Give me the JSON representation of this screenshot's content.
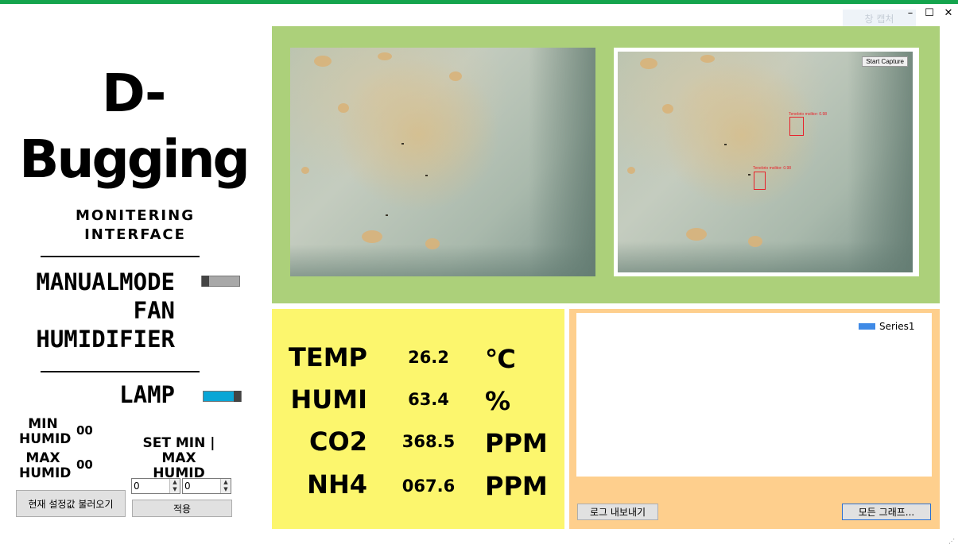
{
  "window": {
    "minimize_glyph": "–",
    "maximize_glyph": "☐",
    "close_glyph": "✕",
    "ghost_button_label": "창 캡처"
  },
  "logo": {
    "line1": "D-",
    "line2": "Bugging",
    "sub1": "MONITERING",
    "sub2": "INTERFACE"
  },
  "controls": {
    "manualmode_label": "MANUALMODE",
    "fan_label": "FAN",
    "humidifier_label": "HUMIDIFIER",
    "lamp_label": "LAMP",
    "manualmode_on": false,
    "lamp_on": true,
    "accent_color": "#0aa6d6"
  },
  "limits": {
    "min_label_1": "MIN",
    "min_label_2": "HUMID",
    "min_value": "00",
    "max_label_1": "MAX",
    "max_label_2": "HUMID",
    "max_value": "00",
    "set_label_1": "SET MIN | MAX",
    "set_label_2": "HUMID",
    "min_input": "0",
    "max_input": "0",
    "load_button": "현재 설정값 불러오기",
    "apply_button": "적용"
  },
  "camera": {
    "start_capture": "Start Capture",
    "detection_label": "Tenebrio molitor: 0.98"
  },
  "sensors": [
    {
      "name": "TEMP",
      "value": "26.2",
      "unit": "℃"
    },
    {
      "name": "HUMI",
      "value": "63.4",
      "unit": "%"
    },
    {
      "name": "CO2",
      "value": "368.5",
      "unit": "PPM"
    },
    {
      "name": "NH4",
      "value": "067.6",
      "unit": "PPM"
    }
  ],
  "chart_data": {
    "type": "line",
    "series": [
      {
        "name": "Series1",
        "values": []
      }
    ],
    "legend": "top-right",
    "legend_color": "#3f8ae6"
  },
  "chart_panel": {
    "export_button": "로그 내보내기",
    "all_graphs_button": "모든 그래프..."
  },
  "colors": {
    "top_bar": "#14a44d",
    "camera_bg": "#acd07a",
    "sensor_bg": "#fcf66d",
    "chart_bg": "#fecf8d"
  }
}
